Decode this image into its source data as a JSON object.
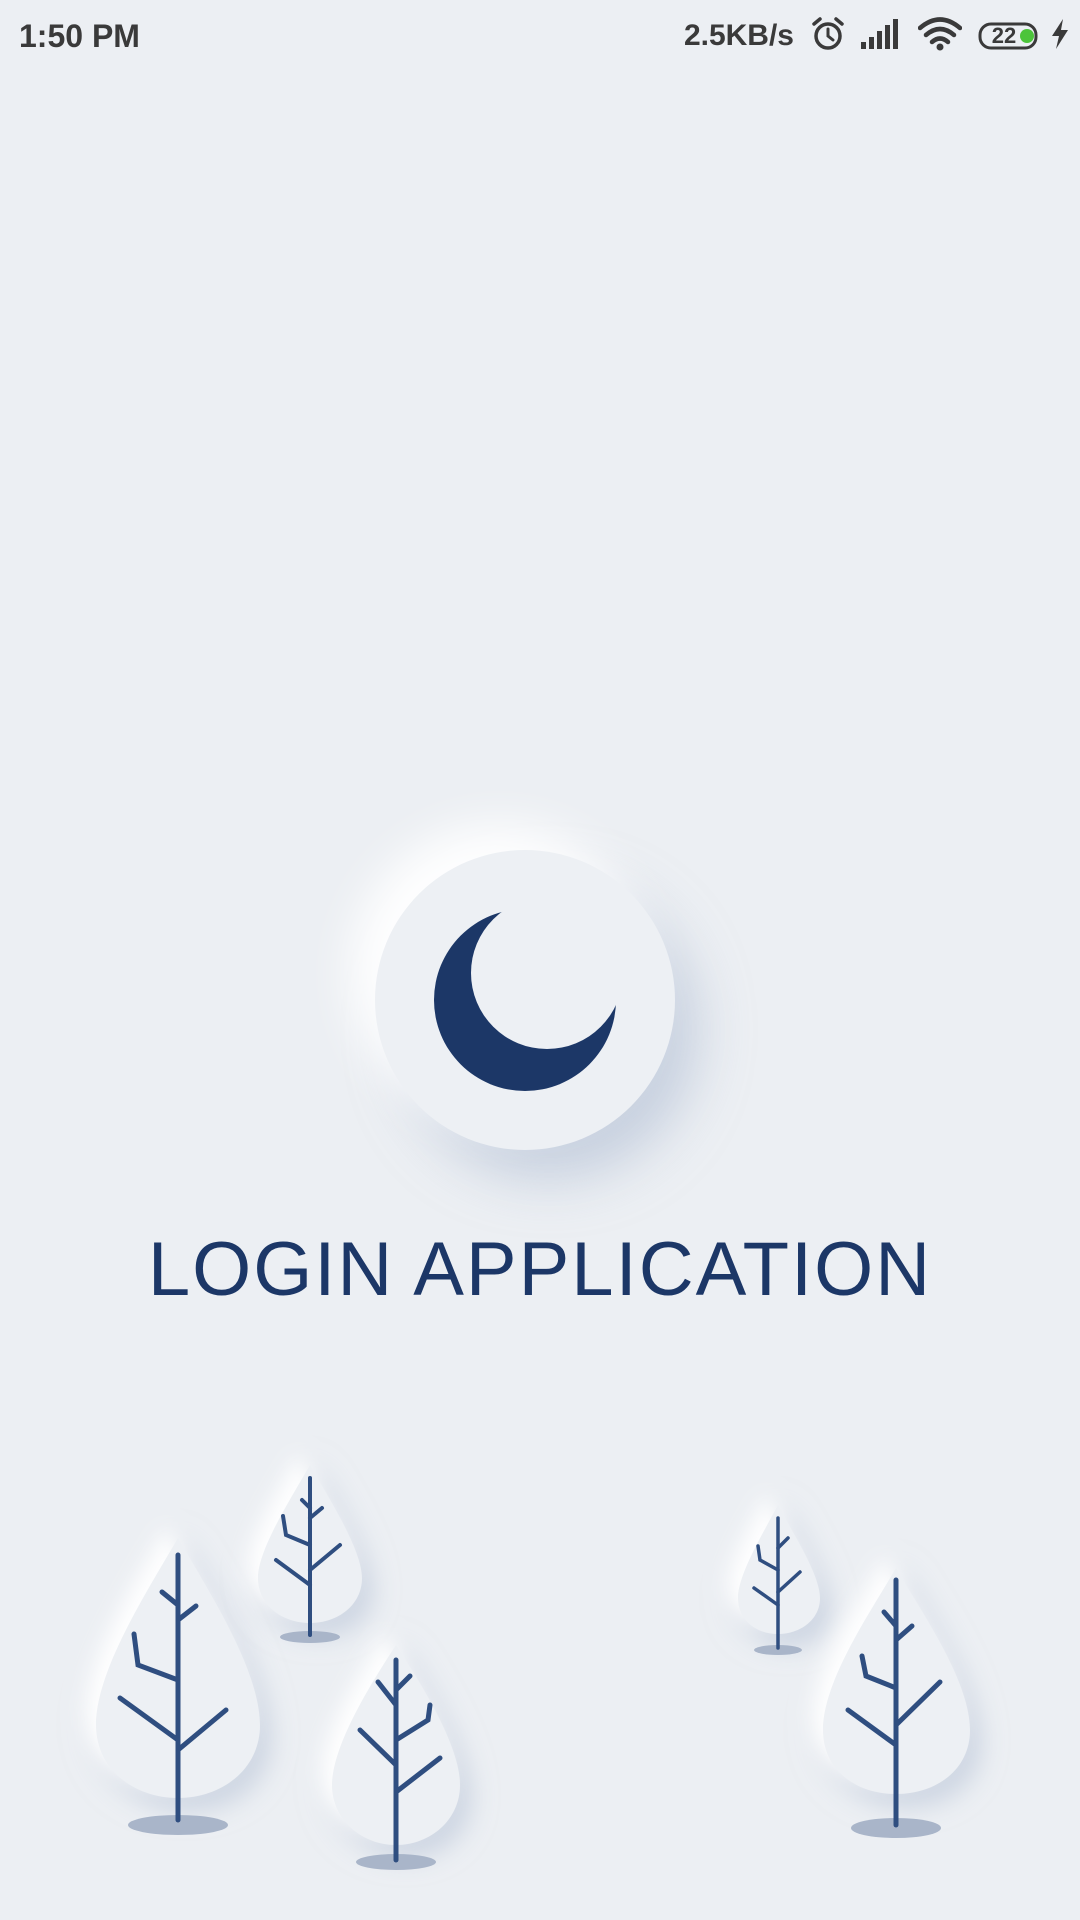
{
  "status_bar": {
    "time": "1:50 PM",
    "network_speed": "2.5KB/s",
    "battery_level": "22",
    "icons": [
      "alarm-icon",
      "signal-icon",
      "wifi-icon",
      "battery-icon",
      "charging-icon"
    ]
  },
  "app": {
    "title": "LOGIN APPLICATION",
    "logo": "crescent-moon-icon"
  },
  "colors": {
    "background": "#ECEFF3",
    "brand": "#1C3767",
    "battery_accent": "#4CC43A"
  }
}
